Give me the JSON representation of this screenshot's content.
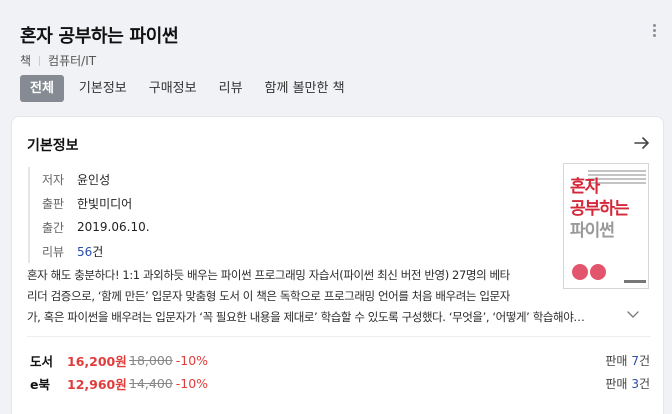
{
  "book": {
    "title": "혼자 공부하는 파이썬",
    "category_type": "책",
    "category": "컴퓨터/IT"
  },
  "tabs": [
    {
      "label": "전체",
      "active": true
    },
    {
      "label": "기본정보"
    },
    {
      "label": "구매정보"
    },
    {
      "label": "리뷰"
    },
    {
      "label": "함께 볼만한 책"
    }
  ],
  "basic_info": {
    "section_title": "기본정보",
    "rows": [
      {
        "key": "저자",
        "value": "윤인성"
      },
      {
        "key": "출판",
        "value": "한빛미디어"
      },
      {
        "key": "출간",
        "value": "2019.06.10."
      },
      {
        "key": "리뷰",
        "value": "56",
        "suffix": "건"
      }
    ],
    "description_lines": [
      "혼자 해도 충분하다! 1:1 과외하듯 배우는 파이썬 프로그래밍 자습서(파이썬 최신 버전 반영) 27명의 베타",
      "리더 검증으로, ‘함께 만든’ 입문자 맞춤형 도서 이 책은 독학으로 프로그래밍 언어를 처음 배우려는 입문자",
      "가, 혹은 파이썬을 배우려는 입문자가 ‘꼭 필요한 내용을 제대로’ 학습할 수 있도록 구성했다. ‘무엇을’, ‘어떻게’ 학습해야…"
    ]
  },
  "cover": {
    "title_parts": [
      "혼자",
      "공부하는",
      "파이썬"
    ]
  },
  "prices": [
    {
      "label": "도서",
      "sale": "16,200원",
      "original": "18,000",
      "discount": "-10%",
      "sellers_label": "판매",
      "sellers_count": "7",
      "sellers_unit": "건"
    },
    {
      "label": "e북",
      "sale": "12,960원",
      "original": "14,400",
      "discount": "-10%",
      "sellers_label": "판매",
      "sellers_count": "3",
      "sellers_unit": "건"
    }
  ],
  "colors": {
    "accent_link": "#2a4fa5",
    "price_red": "#e03c3c",
    "active_tab_bg": "#868b93"
  },
  "icons": [
    "more-vertical-icon",
    "arrow-right-icon",
    "chevron-down-icon"
  ]
}
